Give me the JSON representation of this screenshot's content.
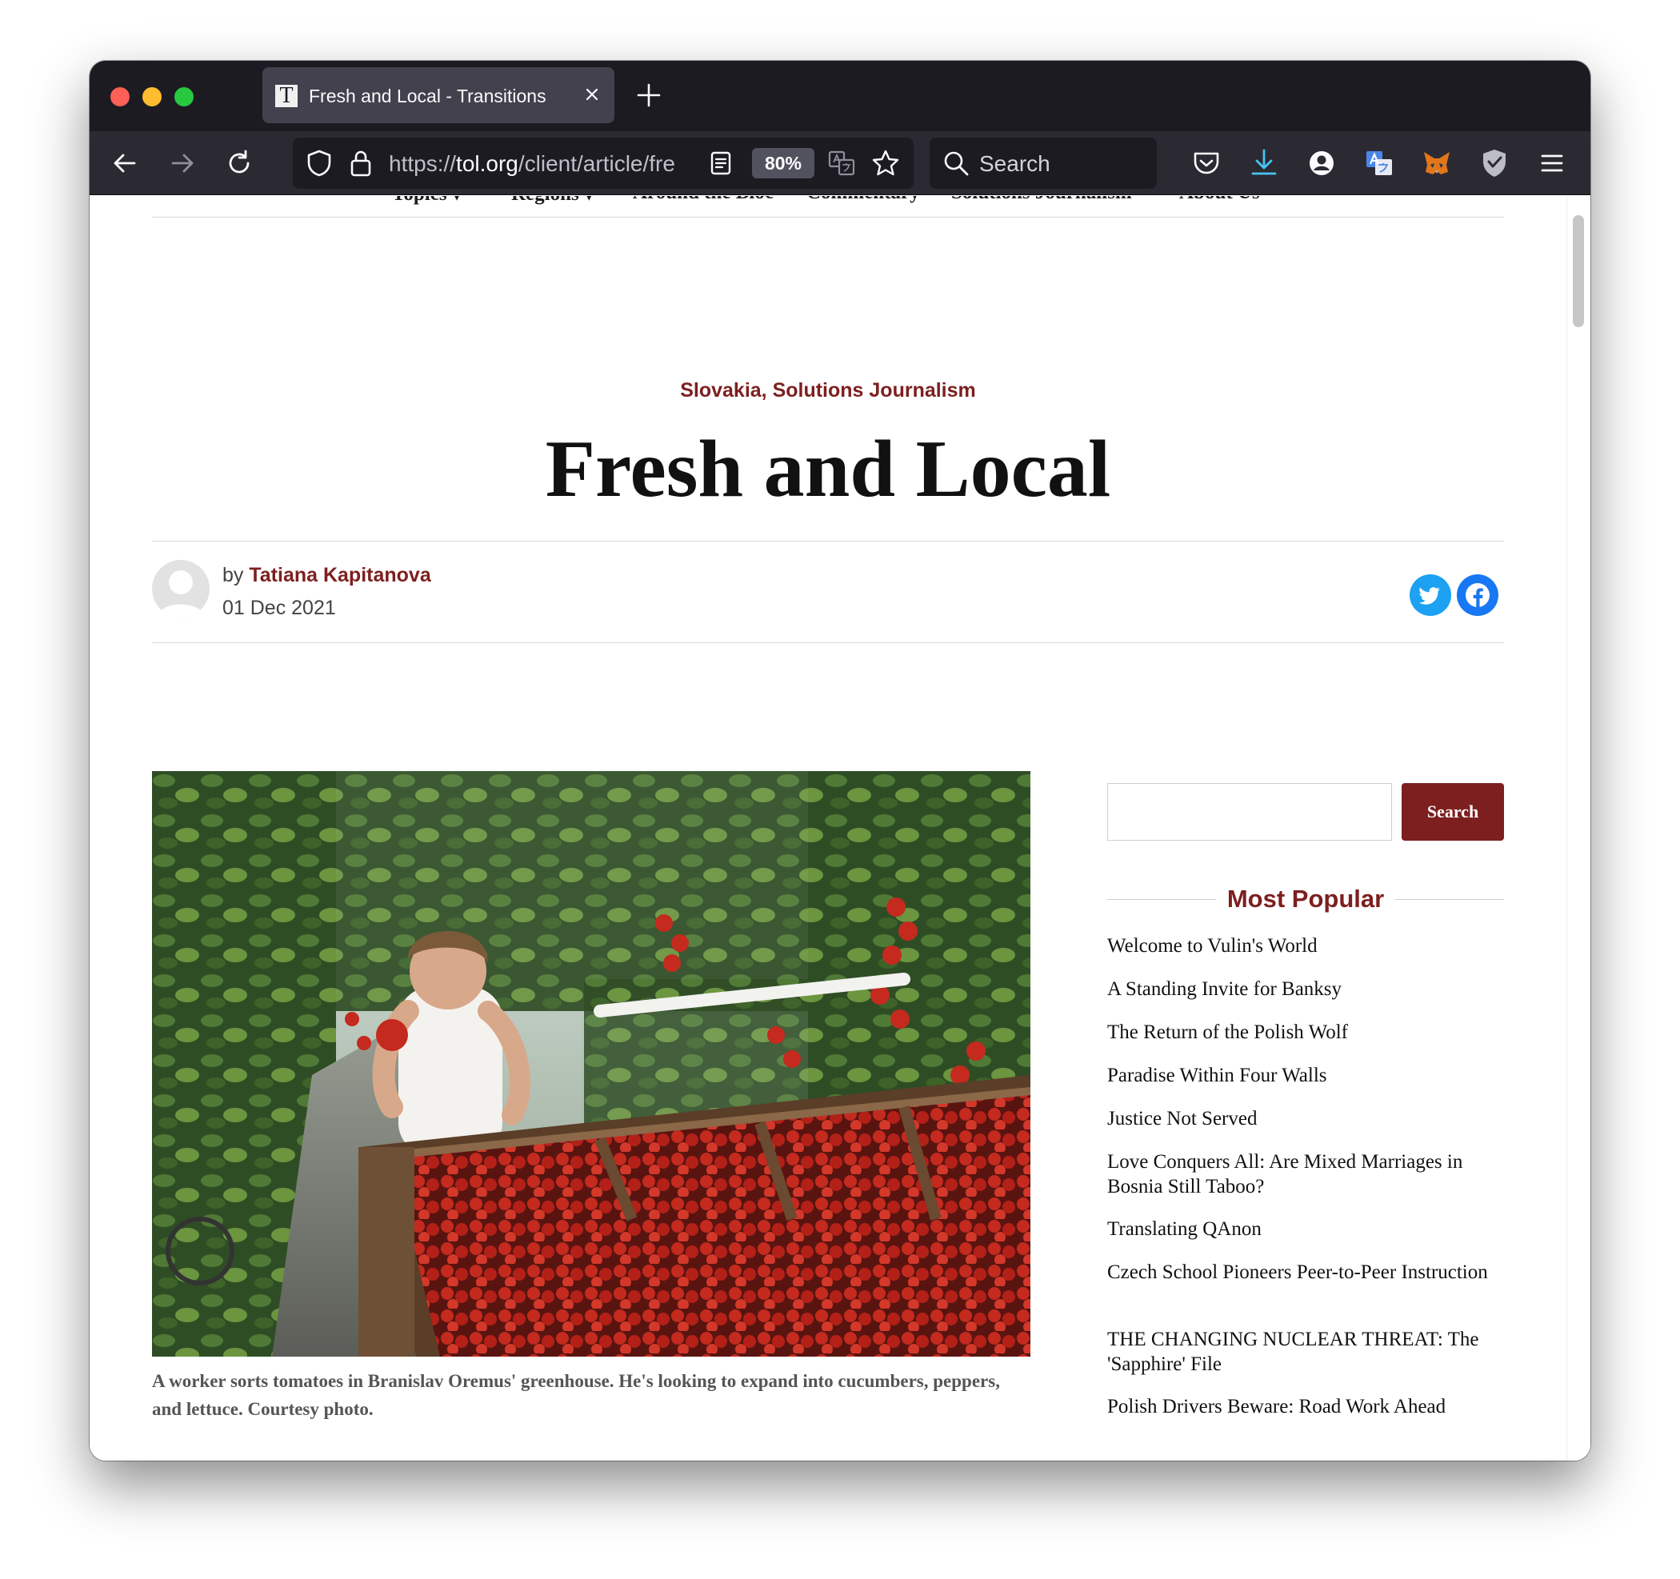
{
  "browser": {
    "tab_title": "Fresh and Local - Transitions",
    "tab_favicon_letter": "T",
    "url_scheme": "https://",
    "url_domain": "tol.org",
    "url_path": "/client/article/fre",
    "zoom_level": "80%",
    "search_placeholder": "Search"
  },
  "site_nav": {
    "items": [
      "Topics ▾",
      "Regions ▾",
      "Around the Bloc",
      "Commentary",
      "Solutions Journalism",
      "About Us"
    ]
  },
  "article": {
    "categories": "Slovakia, Solutions Journalism",
    "title": "Fresh and Local",
    "byline_prefix": "by",
    "author": "Tatiana Kapitanova",
    "date": "01 Dec 2021",
    "image_caption": "A worker sorts tomatoes in Branislav Oremus' greenhouse. He's looking to expand into cucumbers, peppers, and lettuce. Courtesy photo."
  },
  "sidebar": {
    "search_button": "Search",
    "most_popular_title": "Most Popular",
    "most_popular": [
      "Welcome to Vulin's World",
      "A Standing Invite for Banksy",
      "The Return of the Polish Wolf",
      "Paradise Within Four Walls",
      "Justice Not Served",
      "Love Conquers All: Are Mixed Marriages in Bosnia Still Taboo?",
      "Translating QAnon",
      "Czech School Pioneers Peer-to-Peer Instruction",
      "THE CHANGING NUCLEAR THREAT: The 'Sapphire' File",
      "Polish Drivers Beware: Road Work Ahead"
    ]
  },
  "colors": {
    "brand_red": "#7d1f1f",
    "twitter_blue": "#1da1f2",
    "facebook_blue": "#1877f2",
    "browser_dark": "#1c1b22"
  },
  "icons": [
    "back-icon",
    "forward-icon",
    "reload-icon",
    "shield-icon",
    "lock-icon",
    "reader-view-icon",
    "translate-icon",
    "bookmark-star-icon",
    "search-icon",
    "pocket-icon",
    "download-icon",
    "account-icon",
    "extension-icon",
    "metamask-fox-icon",
    "privacy-badger-icon",
    "menu-icon",
    "twitter-icon",
    "facebook-icon"
  ]
}
